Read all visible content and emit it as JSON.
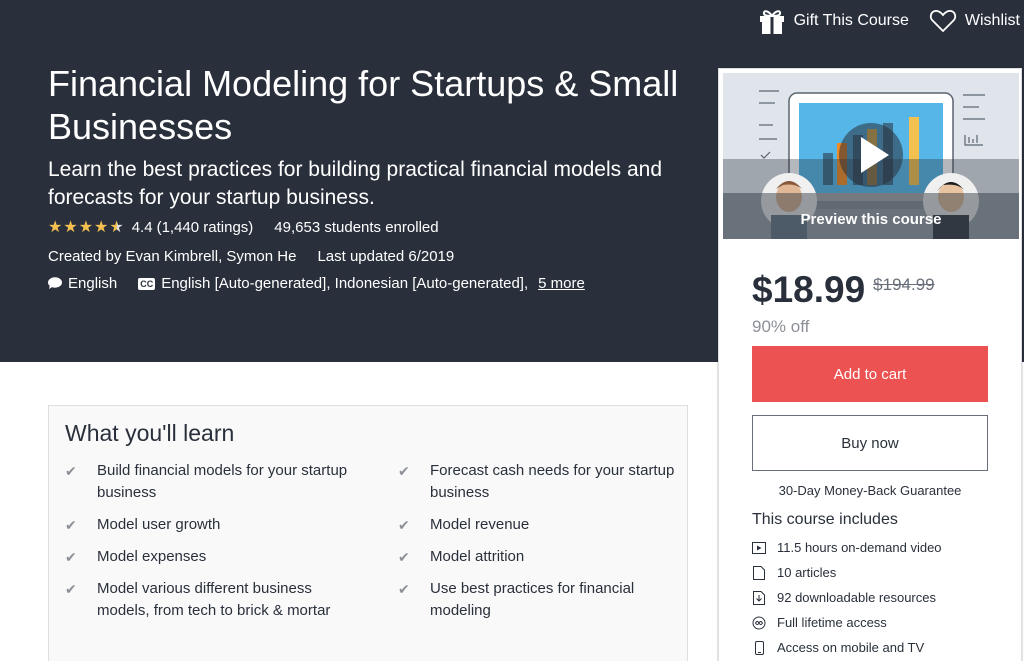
{
  "header": {
    "gift_label": "Gift This Course",
    "wishlist_label": "Wishlist"
  },
  "course": {
    "title": "Financial Modeling for Startups & Small Businesses",
    "subtitle": "Learn the best practices for building practical financial models and forecasts for your startup business.",
    "rating": "4.4",
    "rating_value": 4.4,
    "ratings_count": "(1,440 ratings)",
    "enrolled": "49,653 students enrolled",
    "created_by": "Created by Evan Kimbrell, Symon He",
    "last_updated": "Last updated 6/2019",
    "language": "English",
    "captions": "English [Auto-generated], Indonesian [Auto-generated],",
    "more_link": "5 more"
  },
  "sidebar": {
    "preview_label": "Preview this course",
    "price": "$18.99",
    "original_price": "$194.99",
    "discount": "90% off",
    "add_to_cart": "Add to cart",
    "buy_now": "Buy now",
    "guarantee": "30-Day Money-Back Guarantee",
    "includes_title": "This course includes",
    "includes": [
      {
        "icon": "video-icon",
        "label": "11.5 hours on-demand video"
      },
      {
        "icon": "article-icon",
        "label": "10 articles"
      },
      {
        "icon": "download-icon",
        "label": "92 downloadable resources"
      },
      {
        "icon": "infinity-icon",
        "label": "Full lifetime access"
      },
      {
        "icon": "mobile-icon",
        "label": "Access on mobile and TV"
      }
    ]
  },
  "learn": {
    "title": "What you'll learn",
    "left": [
      "Build financial models for your startup business",
      "Model user growth",
      "Model expenses",
      "Model various different business models, from tech to brick & mortar"
    ],
    "right": [
      "Forecast cash needs for your startup business",
      "Model revenue",
      "Model attrition",
      "Use best practices for financial modeling"
    ]
  },
  "colors": {
    "hero_bg": "#29303b",
    "cart_button": "#ec5252",
    "star": "#f4c150"
  }
}
